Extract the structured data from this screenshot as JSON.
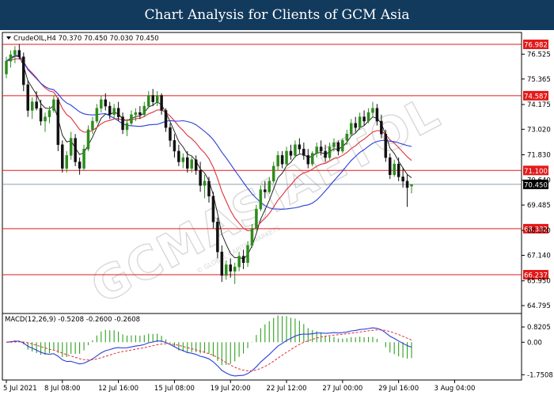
{
  "banner": {
    "title": "Chart Analysis for Clients of GCM Asia"
  },
  "watermark": {
    "text": "GCMASIAETOL",
    "sub": "© GLOBAL CAPITAL MARKETS"
  },
  "colors": {
    "banner": "#123a5c",
    "bull": "#2e8b1e",
    "bear": "#111111",
    "level": "#e31a1a",
    "ma_blue": "#2a3fd8",
    "ma_red": "#e0303a",
    "ma_black": "#111111",
    "macd_line": "#2a3fd8",
    "signal": "#e0303a",
    "hist": "#2ea01e",
    "current": "#6b7f8c"
  },
  "chart_data": [
    {
      "type": "candlestick",
      "header": "CrudeOIL,H4  70.370 70.450 70.030 70.450",
      "symbol_icon": "triangle-down-icon",
      "ylim": [
        64.5,
        77.5
      ],
      "price_ticks": [
        "76.525",
        "75.365",
        "74.175",
        "73.020",
        "71.830",
        "70.640",
        "69.485",
        "68.300",
        "67.140",
        "65.950",
        "64.795"
      ],
      "price_tick_values": [
        76.525,
        75.365,
        74.175,
        73.02,
        71.83,
        70.64,
        69.485,
        68.3,
        67.14,
        65.95,
        64.795
      ],
      "levels": [
        {
          "label": "76.982",
          "value": 76.982
        },
        {
          "label": "74.587",
          "value": 74.587
        },
        {
          "label": "71.100",
          "value": 71.1
        },
        {
          "label": "68.382",
          "value": 68.382
        },
        {
          "label": "66.237",
          "value": 66.237
        }
      ],
      "current_price": {
        "label": "70.450",
        "value": 70.45
      },
      "x_labels": [
        "5 Jul 2021",
        "8 Jul 08:00",
        "12 Jul 16:00",
        "15 Jul 08:00",
        "19 Jul 20:00",
        "22 Jul 12:00",
        "27 Jul 00:00",
        "29 Jul 16:00",
        "3 Aug 04:00"
      ],
      "x_label_index": [
        0,
        13,
        26,
        39,
        52,
        65,
        78,
        91,
        104
      ],
      "candles": [
        [
          75.6,
          76.4,
          75.4,
          76.2
        ],
        [
          76.2,
          76.7,
          75.9,
          76.5
        ],
        [
          76.5,
          76.9,
          76.1,
          76.7
        ],
        [
          76.7,
          77.0,
          76.3,
          76.4
        ],
        [
          76.4,
          76.6,
          74.8,
          75.1
        ],
        [
          75.1,
          75.3,
          73.6,
          73.9
        ],
        [
          73.9,
          74.5,
          73.5,
          74.3
        ],
        [
          74.3,
          74.8,
          73.9,
          74.0
        ],
        [
          74.0,
          74.4,
          73.2,
          73.4
        ],
        [
          73.4,
          73.8,
          72.9,
          73.6
        ],
        [
          73.6,
          74.1,
          73.3,
          73.9
        ],
        [
          73.9,
          74.6,
          73.8,
          74.4
        ],
        [
          74.4,
          74.5,
          72.0,
          72.3
        ],
        [
          72.3,
          72.5,
          71.0,
          71.2
        ],
        [
          71.2,
          72.0,
          71.0,
          71.8
        ],
        [
          71.8,
          72.9,
          71.6,
          72.6
        ],
        [
          72.6,
          72.8,
          71.3,
          71.5
        ],
        [
          71.5,
          71.7,
          70.9,
          71.2
        ],
        [
          71.2,
          72.3,
          71.1,
          72.1
        ],
        [
          72.1,
          73.2,
          72.0,
          73.0
        ],
        [
          73.0,
          73.6,
          72.8,
          73.4
        ],
        [
          73.4,
          74.2,
          73.3,
          74.0
        ],
        [
          74.0,
          74.6,
          73.8,
          74.4
        ],
        [
          74.4,
          74.7,
          73.9,
          74.1
        ],
        [
          74.1,
          74.3,
          73.5,
          73.7
        ],
        [
          73.7,
          74.2,
          73.5,
          74.0
        ],
        [
          74.0,
          74.3,
          73.4,
          73.6
        ],
        [
          73.6,
          73.8,
          72.8,
          73.0
        ],
        [
          73.0,
          73.5,
          72.7,
          73.3
        ],
        [
          73.3,
          73.9,
          73.2,
          73.7
        ],
        [
          73.7,
          74.0,
          73.4,
          73.8
        ],
        [
          73.8,
          74.1,
          73.5,
          73.7
        ],
        [
          73.7,
          74.3,
          73.6,
          74.1
        ],
        [
          74.1,
          74.8,
          74.0,
          74.6
        ],
        [
          74.6,
          74.9,
          74.1,
          74.3
        ],
        [
          74.3,
          74.8,
          74.1,
          74.6
        ],
        [
          74.6,
          74.7,
          73.7,
          73.9
        ],
        [
          73.9,
          74.0,
          72.9,
          73.1
        ],
        [
          73.1,
          73.3,
          72.2,
          72.5
        ],
        [
          72.5,
          72.8,
          71.7,
          72.0
        ],
        [
          72.0,
          72.3,
          71.3,
          71.5
        ],
        [
          71.5,
          71.9,
          71.2,
          71.7
        ],
        [
          71.7,
          72.0,
          71.0,
          71.2
        ],
        [
          71.2,
          71.8,
          71.0,
          71.6
        ],
        [
          71.6,
          71.8,
          70.9,
          71.1
        ],
        [
          71.1,
          71.5,
          70.1,
          70.4
        ],
        [
          70.4,
          70.9,
          69.8,
          70.6
        ],
        [
          70.6,
          70.8,
          69.6,
          69.9
        ],
        [
          69.9,
          70.1,
          68.4,
          68.7
        ],
        [
          68.7,
          68.9,
          67.0,
          67.3
        ],
        [
          67.3,
          67.6,
          65.9,
          66.2
        ],
        [
          66.2,
          66.9,
          66.0,
          66.7
        ],
        [
          66.7,
          67.0,
          66.1,
          66.4
        ],
        [
          66.4,
          66.8,
          65.8,
          66.6
        ],
        [
          66.6,
          67.3,
          66.4,
          67.1
        ],
        [
          67.1,
          67.4,
          66.5,
          66.8
        ],
        [
          66.8,
          67.8,
          66.6,
          67.6
        ],
        [
          67.6,
          68.6,
          67.5,
          68.4
        ],
        [
          68.4,
          69.5,
          68.3,
          69.3
        ],
        [
          69.3,
          70.4,
          69.2,
          70.2
        ],
        [
          70.2,
          70.6,
          69.8,
          70.1
        ],
        [
          70.1,
          70.8,
          70.0,
          70.6
        ],
        [
          70.6,
          71.5,
          70.5,
          71.3
        ],
        [
          71.3,
          72.0,
          71.1,
          71.8
        ],
        [
          71.8,
          72.0,
          71.2,
          71.4
        ],
        [
          71.4,
          72.2,
          71.3,
          72.0
        ],
        [
          72.0,
          72.3,
          71.6,
          71.8
        ],
        [
          71.8,
          72.5,
          71.7,
          72.3
        ],
        [
          72.3,
          72.6,
          71.9,
          72.1
        ],
        [
          72.1,
          72.4,
          71.6,
          71.8
        ],
        [
          71.8,
          72.1,
          71.2,
          71.4
        ],
        [
          71.4,
          72.0,
          71.3,
          71.9
        ],
        [
          71.9,
          72.4,
          71.7,
          72.2
        ],
        [
          72.2,
          72.5,
          71.8,
          72.0
        ],
        [
          72.0,
          72.3,
          71.5,
          71.7
        ],
        [
          71.7,
          72.4,
          71.6,
          72.2
        ],
        [
          72.2,
          72.6,
          72.0,
          72.4
        ],
        [
          72.4,
          72.5,
          71.8,
          72.0
        ],
        [
          72.0,
          72.6,
          71.9,
          72.5
        ],
        [
          72.5,
          73.0,
          72.3,
          72.8
        ],
        [
          72.8,
          73.5,
          72.7,
          73.3
        ],
        [
          73.3,
          73.6,
          72.9,
          73.1
        ],
        [
          73.1,
          73.8,
          73.0,
          73.6
        ],
        [
          73.6,
          73.9,
          73.2,
          73.4
        ],
        [
          73.4,
          74.0,
          73.3,
          73.8
        ],
        [
          73.8,
          74.3,
          73.6,
          74.0
        ],
        [
          74.0,
          74.2,
          73.2,
          73.4
        ],
        [
          73.4,
          73.7,
          72.6,
          72.8
        ],
        [
          72.8,
          73.0,
          71.5,
          71.7
        ],
        [
          71.7,
          71.9,
          70.7,
          70.9
        ],
        [
          70.9,
          71.6,
          70.8,
          71.4
        ],
        [
          71.4,
          71.7,
          70.6,
          70.8
        ],
        [
          70.8,
          71.2,
          70.3,
          70.6
        ],
        [
          70.6,
          70.9,
          69.4,
          70.3
        ],
        [
          70.37,
          70.45,
          70.03,
          70.45
        ]
      ]
    },
    {
      "type": "histogram-line",
      "header": "MACD(12,26,9) -0.5208 -0.2600 -0.2608",
      "ylim": [
        -1.95,
        0.95
      ],
      "y_ticks": [
        "0.8205",
        "0.00",
        "-1.7508"
      ],
      "y_tick_values": [
        0.8205,
        0.0,
        -1.7508
      ]
    }
  ]
}
